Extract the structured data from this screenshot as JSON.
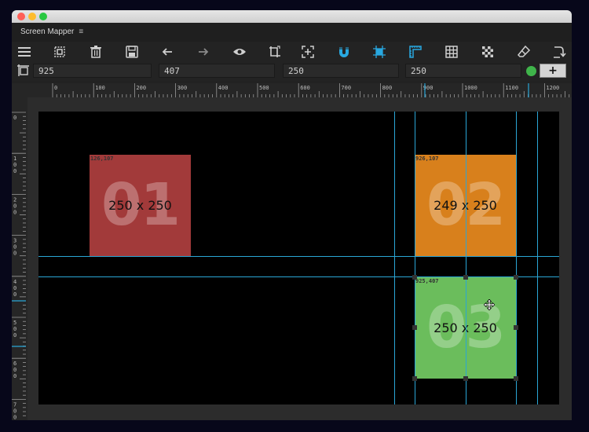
{
  "window": {
    "title_tab": "Screen Mapper",
    "traffic_lights": [
      {
        "name": "close",
        "color": "#ff5f57"
      },
      {
        "name": "minimize",
        "color": "#febc2e"
      },
      {
        "name": "zoom",
        "color": "#28c840"
      }
    ]
  },
  "toolbar": {
    "icons": [
      "hamburger-menu-icon",
      "select-frame-icon",
      "trash-icon",
      "save-icon",
      "arrow-left-icon",
      "arrow-right-icon",
      "eye-icon",
      "crop-transform-icon",
      "add-region-icon",
      "magnet-icon",
      "snap-crosshair-icon",
      "ruler-icon",
      "grid-icon",
      "checkerboard-icon",
      "eraser-icon",
      "export-arrow-icon"
    ],
    "active_color": "#29a8e0"
  },
  "fields": {
    "x": "925",
    "y": "407",
    "w": "250",
    "h": "250",
    "status_color": "#3fb44a",
    "add_label": "+"
  },
  "ruler": {
    "h_labels": [
      "0",
      "100",
      "200",
      "300",
      "400",
      "500",
      "600",
      "700",
      "800",
      "900",
      "1000",
      "1100",
      "1200"
    ],
    "v_labels": [
      "0",
      "100",
      "200",
      "300",
      "400",
      "500",
      "600",
      "700"
    ]
  },
  "boxes": [
    {
      "number": "01",
      "size": "250 x 250",
      "coord": "126,107",
      "color": "#a23a3a"
    },
    {
      "number": "02",
      "size": "249 x 250",
      "coord": "926,107",
      "color": "#d8801c"
    },
    {
      "number": "03",
      "size": "250 x 250",
      "coord": "925,407",
      "color": "#6bbd5c"
    }
  ]
}
